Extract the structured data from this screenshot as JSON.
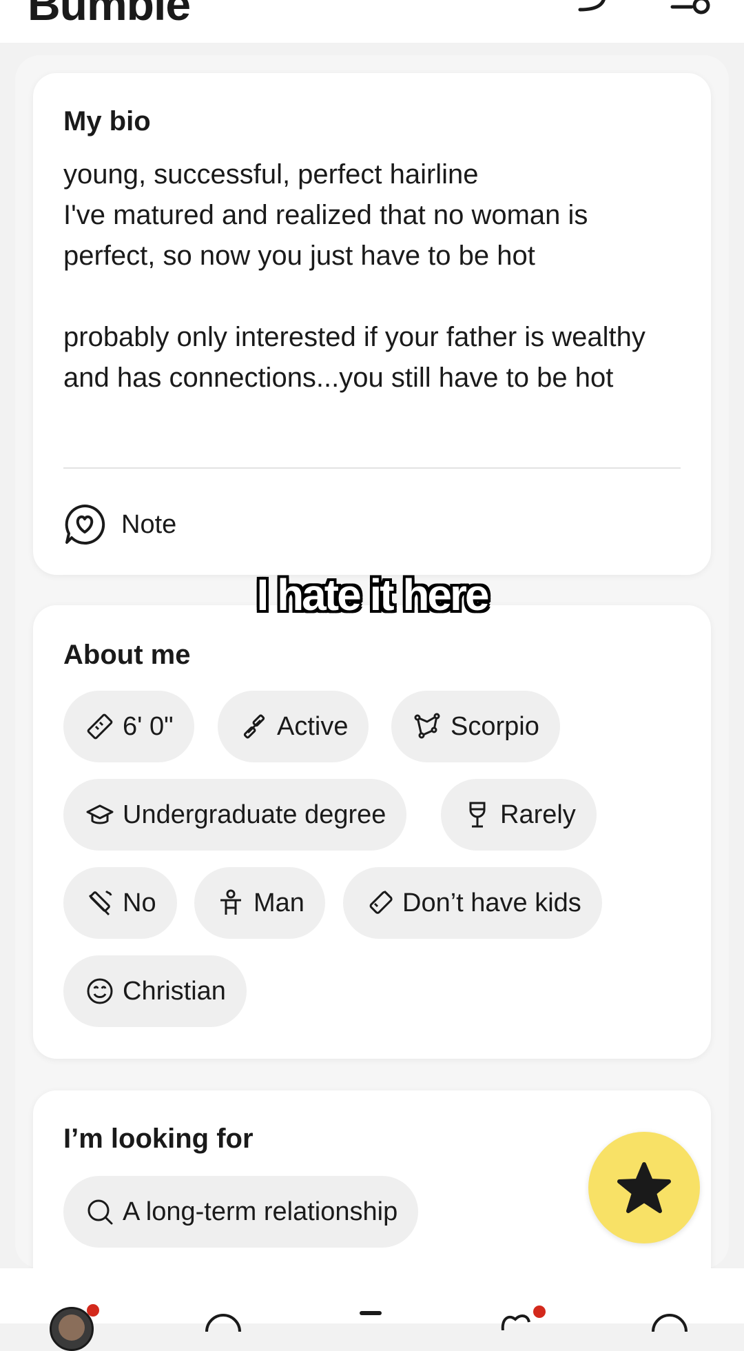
{
  "app": {
    "title": "Bumble"
  },
  "bio_card": {
    "title": "My bio",
    "text": "young, successful, perfect hairline\nI've matured and realized that no woman is perfect, so now you just have to be hot\n\nprobably only interested if your father is wealthy and has connections...you still have to be hot",
    "note_label": "Note"
  },
  "caption": "I hate it here",
  "about_card": {
    "title": "About me",
    "chips": [
      {
        "label": "6' 0\"",
        "icon": "ruler-icon"
      },
      {
        "label": "Active",
        "icon": "dumbbell-icon"
      },
      {
        "label": "Scorpio",
        "icon": "constellation-icon"
      },
      {
        "label": "Undergraduate degree",
        "icon": "graduation-cap-icon"
      },
      {
        "label": "Rarely",
        "icon": "wine-glass-icon"
      },
      {
        "label": "No",
        "icon": "no-smoking-icon"
      },
      {
        "label": "Man",
        "icon": "person-icon"
      },
      {
        "label": "Don’t have kids",
        "icon": "baby-bottle-icon"
      },
      {
        "label": "Christian",
        "icon": "smiley-icon"
      }
    ]
  },
  "looking_card": {
    "title": "I’m looking for",
    "chips": [
      {
        "label": "A long-term relationship",
        "icon": "search-icon"
      }
    ]
  },
  "colors": {
    "accent_yellow": "#f8e166",
    "notification_red": "#d3291c",
    "chip_bg": "#efefef"
  }
}
